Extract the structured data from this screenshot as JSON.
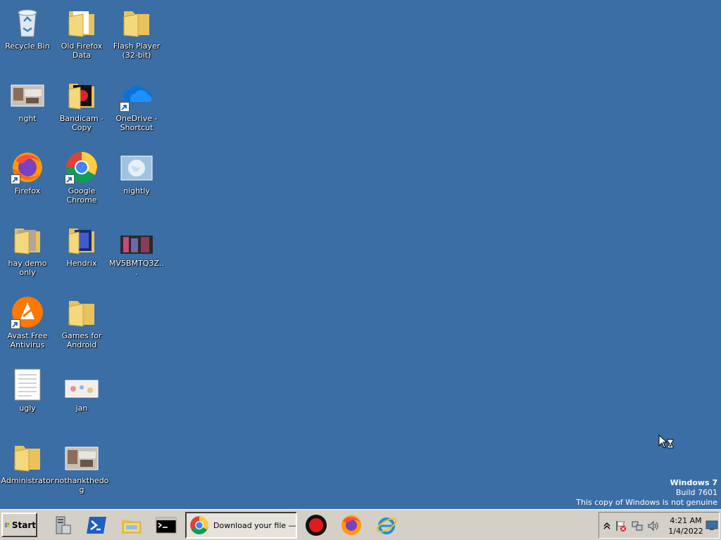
{
  "desktop": {
    "icons": [
      {
        "label": "Recycle Bin"
      },
      {
        "label": "Old Firefox Data"
      },
      {
        "label": "Flash Player (32-bit)"
      },
      {
        "label": "nght"
      },
      {
        "label": "Bandicam - Copy"
      },
      {
        "label": "OneDrive - Shortcut"
      },
      {
        "label": "Firefox"
      },
      {
        "label": "Google Chrome"
      },
      {
        "label": "nightly"
      },
      {
        "label": "hay demo only"
      },
      {
        "label": "Hendrix"
      },
      {
        "label": "MV5BMTQ3Z..."
      },
      {
        "label": "Avast Free Antivirus"
      },
      {
        "label": "Games for Android"
      },
      {
        "label": "ugly"
      },
      {
        "label": "jan"
      },
      {
        "label": "Administrator"
      },
      {
        "label": "nothankthedog"
      }
    ]
  },
  "watermark": {
    "os": "Windows 7",
    "build": "Build 7601",
    "notice": "This copy of Windows is not genuine"
  },
  "taskbar": {
    "start_label": "Start",
    "active_task_label": "Download your file —...",
    "pinned": [
      "server-manager-icon",
      "powershell-icon",
      "explorer-icon",
      "cmd-icon",
      "chrome-icon",
      "bandicam-icon",
      "firefox-icon",
      "internet-explorer-icon"
    ],
    "tray": {
      "time": "4:21 AM",
      "date": "1/4/2022"
    }
  },
  "colors": {
    "desktop_background": "#3a6ea5",
    "taskbar": "#d4d0c8"
  }
}
